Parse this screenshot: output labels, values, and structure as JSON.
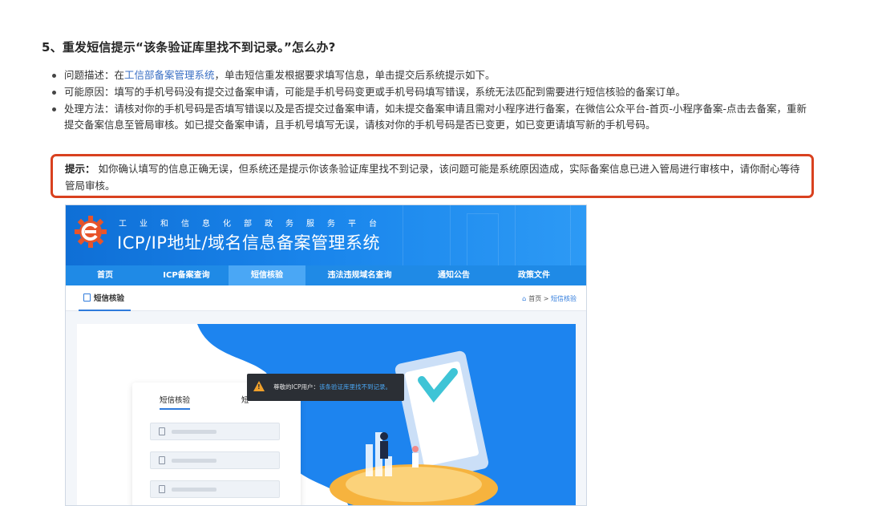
{
  "heading": "5、重发短信提示“该条验证库里找不到记录。”怎么办?",
  "bullets": [
    {
      "prefix": "问题描述：在",
      "link": "工信部备案管理系统",
      "suffix": "，单击短信重发根据要求填写信息，单击提交后系统提示如下。"
    },
    {
      "text": "可能原因：填写的手机号码没有提交过备案申请，可能是手机号码变更或手机号码填写错误，系统无法匹配到需要进行短信核验的备案订单。"
    },
    {
      "text": "处理方法：请核对你的手机号码是否填写错误以及是否提交过备案申请，如未提交备案申请且需对小程序进行备案，在微信公众平台-首页-小程序备案-点击去备案，重新提交备案信息至管局审核。如已提交备案申请，且手机号填写无误，请核对你的手机号码是否已变更，如已变更请填写新的手机号码。"
    }
  ],
  "tip": {
    "label": "提示：",
    "text": "如你确认填写的信息正确无误，但系统还是提示你该条验证库里找不到记录，该问题可能是系统原因造成，实际备案信息已进入管局进行审核中，请你耐心等待管局审核。"
  },
  "screenshot": {
    "banner_subtitle": "工业和信息化部政务服务平台",
    "banner_title": "ICP/IP地址/域名信息备案管理系统",
    "nav": [
      "首页",
      "ICP备案查询",
      "短信核验",
      "违法违规域名查询",
      "通知公告",
      "政策文件"
    ],
    "nav_active_index": 2,
    "tab_label": "短信核验",
    "breadcrumb_home": "首页",
    "breadcrumb_sep": ">",
    "breadcrumb_current": "短信核验",
    "login_tab": "短信核验",
    "login_tab2_partial": "短",
    "toast_prefix": "尊敬的ICP用户：",
    "toast_highlight": "该条验证库里找不到记录。",
    "colors": {
      "brand_blue": "#1a86ec",
      "tip_border": "#d9411f",
      "link": "#3a6fc4",
      "warning": "#f0a12b"
    }
  }
}
